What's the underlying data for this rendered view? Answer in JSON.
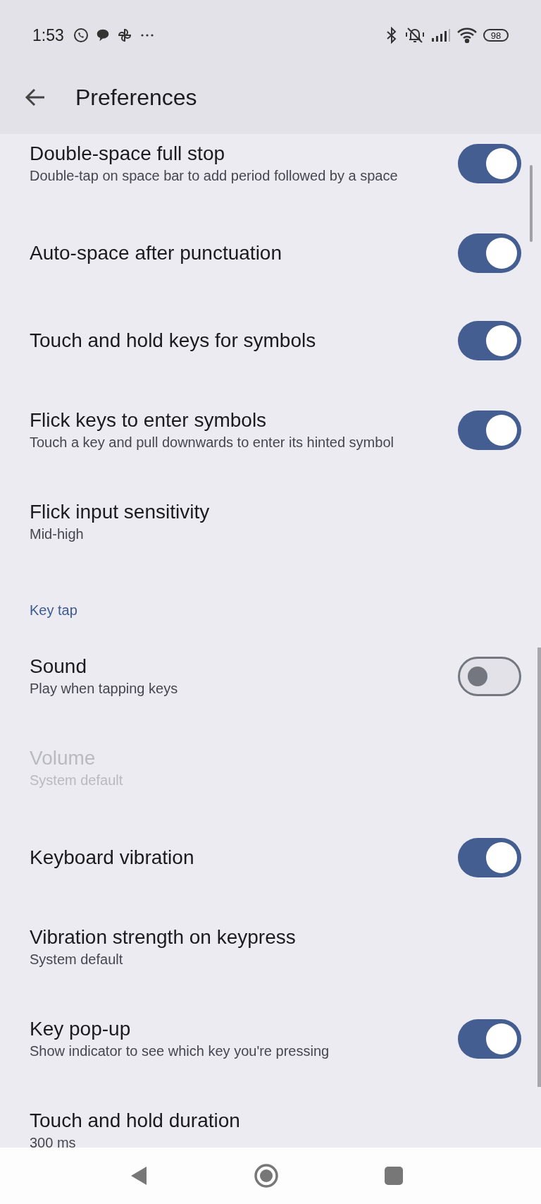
{
  "status_bar": {
    "time": "1:53",
    "battery": "98"
  },
  "app_bar": {
    "title": "Preferences"
  },
  "items": [
    {
      "kind": "switch",
      "title": "Double-space full stop",
      "summary": "Double-tap on space bar to add period followed by a space",
      "on": true
    },
    {
      "kind": "switch",
      "title": "Auto-space after punctuation",
      "on": true
    },
    {
      "kind": "switch",
      "title": "Touch and hold keys for symbols",
      "on": true
    },
    {
      "kind": "switch",
      "title": "Flick keys to enter symbols",
      "summary": "Touch a key and pull downwards to enter its hinted symbol",
      "on": true
    },
    {
      "kind": "plain",
      "title": "Flick input sensitivity",
      "summary": "Mid-high",
      "disabled": false
    },
    {
      "kind": "category",
      "title": "Key tap"
    },
    {
      "kind": "switch",
      "title": "Sound",
      "summary": "Play when tapping keys",
      "on": false
    },
    {
      "kind": "plain",
      "title": "Volume",
      "summary": "System default",
      "disabled": true
    },
    {
      "kind": "switch",
      "title": "Keyboard vibration",
      "on": true
    },
    {
      "kind": "plain",
      "title": "Vibration strength on keypress",
      "summary": "System default",
      "disabled": false
    },
    {
      "kind": "switch",
      "title": "Key pop-up",
      "summary": "Show indicator to see which key you're pressing",
      "on": true
    },
    {
      "kind": "plain",
      "title": "Touch and hold duration",
      "summary": "300 ms",
      "disabled": false
    }
  ]
}
